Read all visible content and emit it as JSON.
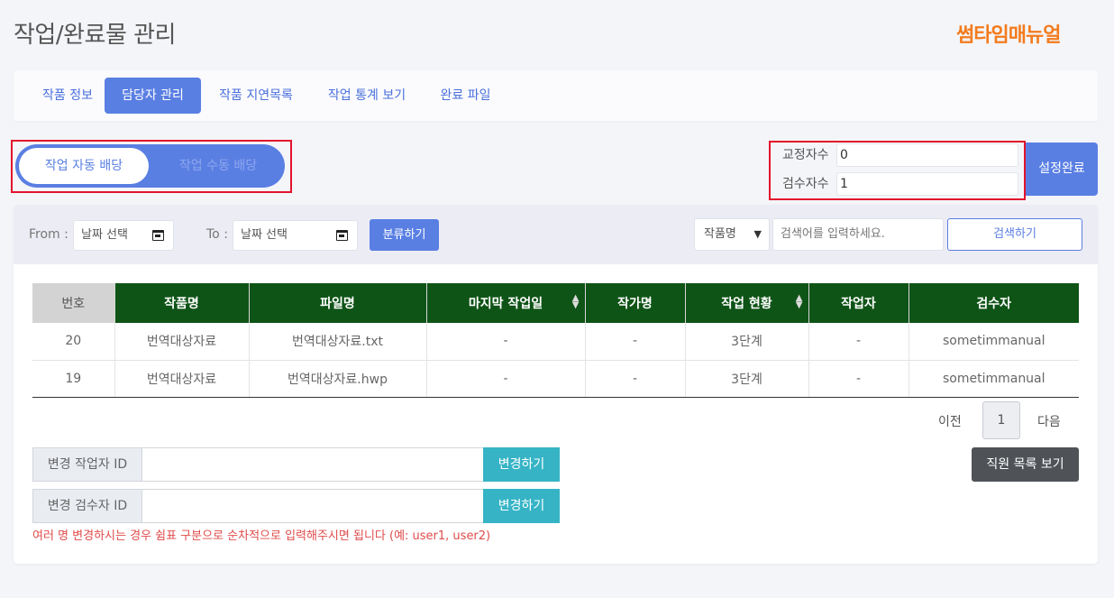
{
  "header": {
    "title": "작업/완료물 관리",
    "logo": "썸타임매뉴얼"
  },
  "tabs": [
    {
      "label": "작품 정보",
      "active": false
    },
    {
      "label": "담당자 관리",
      "active": true
    },
    {
      "label": "작품 지연목록",
      "active": false
    },
    {
      "label": "작업 통계 보기",
      "active": false
    },
    {
      "label": "완료 파일",
      "active": false
    }
  ],
  "assign_toggle": {
    "auto_label": "작업 자동 배당",
    "manual_label": "작업 수동 배당",
    "selected": "auto"
  },
  "counts": {
    "proofreaders_label": "교정자수",
    "proofreaders_value": "0",
    "reviewers_label": "검수자수",
    "reviewers_value": "1",
    "done_label": "설정완료"
  },
  "filter": {
    "from_label": "From :",
    "from_placeholder": "날짜 선택",
    "to_label": "To :",
    "to_placeholder": "날짜 선택",
    "classify_label": "분류하기",
    "select_value": "작품명",
    "search_placeholder": "검색어를 입력하세요.",
    "search_label": "검색하기"
  },
  "table": {
    "headers": [
      "번호",
      "작품명",
      "파일명",
      "마지막 작업일",
      "작가명",
      "작업 현황",
      "작업자",
      "검수자"
    ],
    "rows": [
      [
        "20",
        "번역대상자료",
        "번역대상자료.txt",
        "-",
        "-",
        "3단계",
        "-",
        "sometimmanual"
      ],
      [
        "19",
        "번역대상자료",
        "번역대상자료.hwp",
        "-",
        "-",
        "3단계",
        "-",
        "sometimmanual"
      ]
    ]
  },
  "pager": {
    "prev": "이전",
    "current": "1",
    "next": "다음"
  },
  "change": {
    "worker_label": "변경 작업자 ID",
    "reviewer_label": "변경 검수자 ID",
    "button_label": "변경하기",
    "staff_list_label": "직원 목록 보기",
    "hint": "여러 명 변경하시는 경우 쉼표 구분으로 순차적으로 입력해주시면 됩니다 (예: user1, user2)"
  },
  "colors": {
    "accent": "#5a7fe3",
    "table_header": "#0f5417",
    "teal": "#36b4c6",
    "highlight": "#e3132c",
    "logo": "#f37b1d"
  }
}
